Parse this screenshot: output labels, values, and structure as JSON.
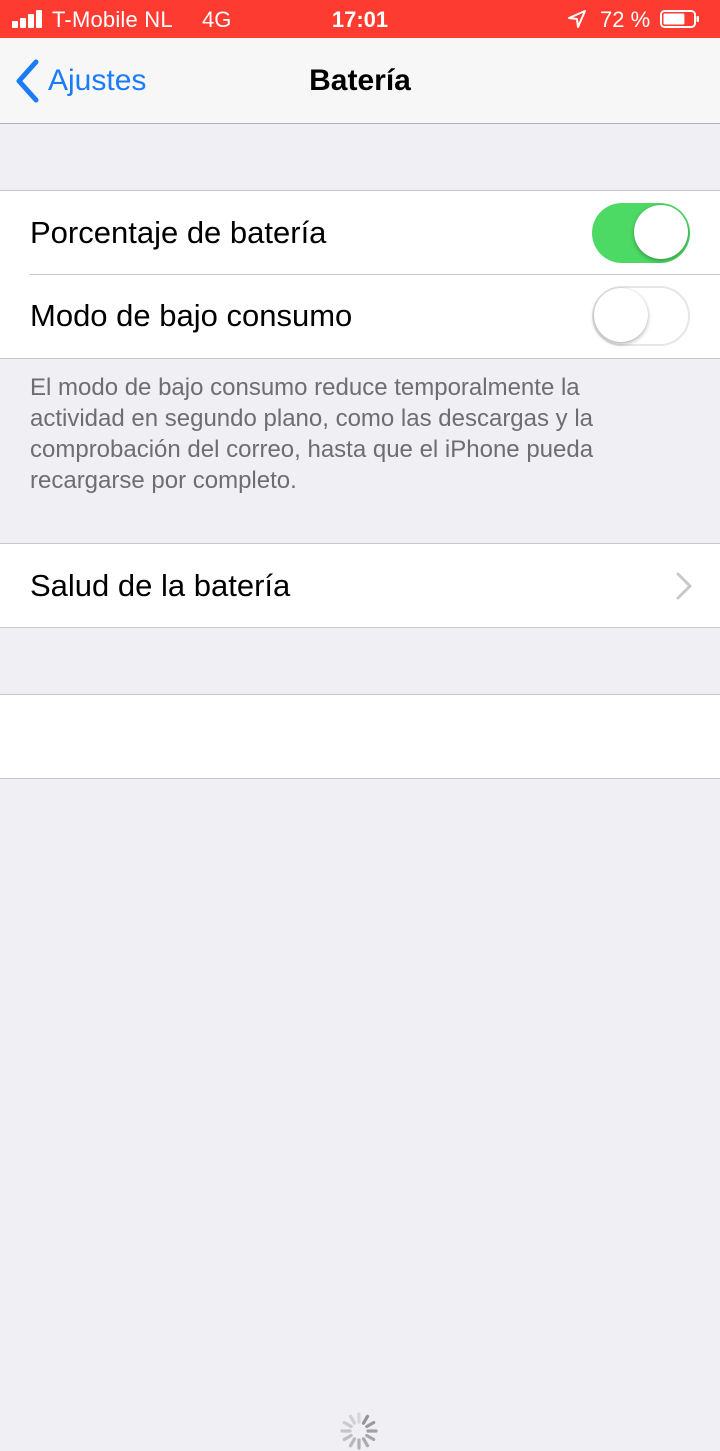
{
  "status_bar": {
    "carrier": "T-Mobile NL",
    "network": "4G",
    "time": "17:01",
    "battery_percent": "72 %",
    "battery_level": 0.72,
    "background_color": "#fe3b30",
    "icons": [
      "signal-bars-icon",
      "location-arrow-icon",
      "battery-icon"
    ]
  },
  "nav": {
    "back_label": "Ajustes",
    "title": "Batería",
    "accent_color": "#1a7cf6"
  },
  "settings": {
    "battery_percentage": {
      "label": "Porcentaje de batería",
      "enabled": true
    },
    "low_power_mode": {
      "label": "Modo de bajo consumo",
      "enabled": false
    },
    "low_power_footer": "El modo de bajo consumo reduce temporalmente la actividad en segundo plano, como las descargas y la comprobación del correo, hasta que el iPhone pueda recargarse por completo.",
    "battery_health": {
      "label": "Salud de la batería"
    },
    "toggle_on_color": "#4cd964"
  },
  "loading": {
    "icon": "activity-spinner-icon"
  }
}
